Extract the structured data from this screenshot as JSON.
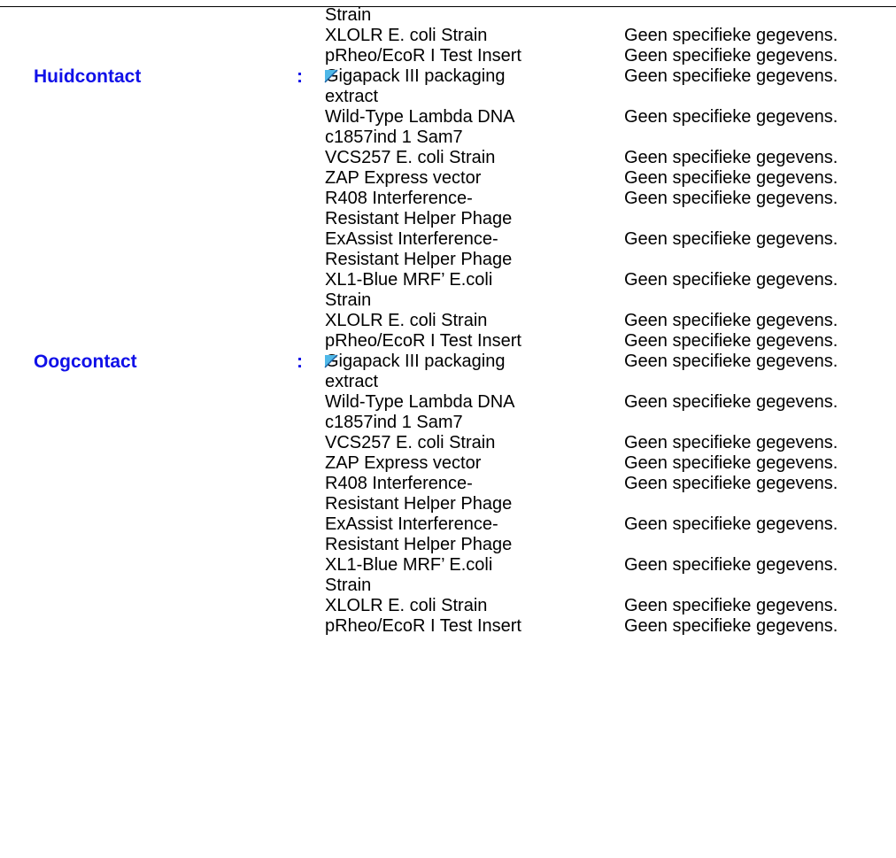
{
  "orphan_continuation": "Strain",
  "head_rows": [
    {
      "name": "XLOLR E. coli Strain",
      "value": "Geen specifieke gegevens."
    },
    {
      "name": "pRheo/EcoR I Test Insert",
      "value": "Geen specifieke gegevens."
    }
  ],
  "sections": [
    {
      "label": "Huidcontact",
      "colon": ":",
      "rows": [
        {
          "name": "Gigapack III packaging",
          "cont": "extract",
          "value": "Geen specifieke gegevens."
        },
        {
          "name": "Wild-Type Lambda DNA",
          "cont": "c1857ind 1 Sam7",
          "value": "Geen specifieke gegevens."
        },
        {
          "name": "VCS257 E. coli Strain",
          "value": "Geen specifieke gegevens."
        },
        {
          "name": "ZAP Express vector",
          "value": "Geen specifieke gegevens."
        },
        {
          "name": "R408 Interference-",
          "cont": "Resistant Helper Phage",
          "value": "Geen specifieke gegevens."
        },
        {
          "name": "ExAssist Interference-",
          "cont": "Resistant Helper Phage",
          "value": "Geen specifieke gegevens."
        },
        {
          "name": "XL1-Blue MRF’ E.coli",
          "cont": "Strain",
          "value": "Geen specifieke gegevens."
        },
        {
          "name": "XLOLR E. coli Strain",
          "value": "Geen specifieke gegevens."
        },
        {
          "name": "pRheo/EcoR I Test Insert",
          "value": "Geen specifieke gegevens."
        }
      ]
    },
    {
      "label": "Oogcontact",
      "colon": ":",
      "rows": [
        {
          "name": "Gigapack III packaging",
          "cont": "extract",
          "value": "Geen specifieke gegevens."
        },
        {
          "name": "Wild-Type Lambda DNA",
          "cont": "c1857ind 1 Sam7",
          "value": "Geen specifieke gegevens."
        },
        {
          "name": "VCS257 E. coli Strain",
          "value": "Geen specifieke gegevens."
        },
        {
          "name": "ZAP Express vector",
          "value": "Geen specifieke gegevens."
        },
        {
          "name": "R408 Interference-",
          "cont": "Resistant Helper Phage",
          "value": "Geen specifieke gegevens."
        },
        {
          "name": "ExAssist Interference-",
          "cont": "Resistant Helper Phage",
          "value": "Geen specifieke gegevens."
        },
        {
          "name": "XL1-Blue MRF’ E.coli",
          "cont": "Strain",
          "value": "Geen specifieke gegevens."
        },
        {
          "name": "XLOLR E. coli Strain",
          "value": "Geen specifieke gegevens."
        },
        {
          "name": "pRheo/EcoR I Test Insert",
          "value": "Geen specifieke gegevens."
        }
      ]
    }
  ],
  "marker_icon": "blue-flag-marker-icon",
  "marker_color": "#4fb8e8"
}
